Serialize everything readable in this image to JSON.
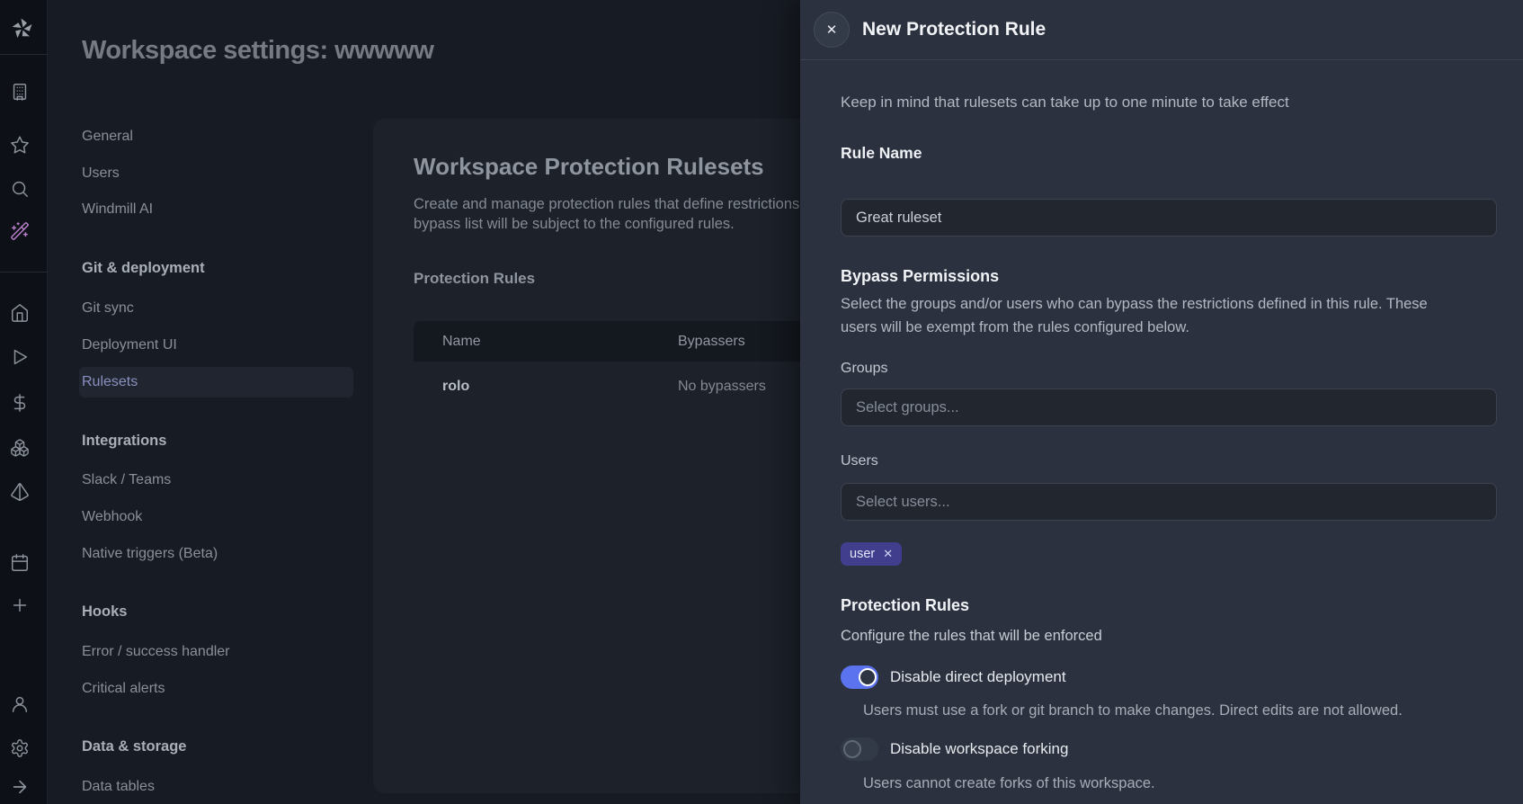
{
  "page": {
    "title": "Workspace settings: wwwww"
  },
  "sidebar_rail": {
    "icons": [
      "windmill-logo",
      "building",
      "star",
      "search",
      "magic-wand",
      "home",
      "play",
      "dollar",
      "boxes",
      "pyramid",
      "calendar",
      "plus",
      "user",
      "settings",
      "arrow-right"
    ]
  },
  "nav": {
    "items": [
      {
        "label": "General",
        "type": "item"
      },
      {
        "label": "Users",
        "type": "item"
      },
      {
        "label": "Windmill AI",
        "type": "item"
      },
      {
        "label": "Git & deployment",
        "type": "header"
      },
      {
        "label": "Git sync",
        "type": "item"
      },
      {
        "label": "Deployment UI",
        "type": "item"
      },
      {
        "label": "Rulesets",
        "type": "item",
        "selected": true
      },
      {
        "label": "Integrations",
        "type": "header"
      },
      {
        "label": "Slack / Teams",
        "type": "item"
      },
      {
        "label": "Webhook",
        "type": "item"
      },
      {
        "label": "Native triggers (Beta)",
        "type": "item"
      },
      {
        "label": "Hooks",
        "type": "header"
      },
      {
        "label": "Error / success handler",
        "type": "item"
      },
      {
        "label": "Critical alerts",
        "type": "item"
      },
      {
        "label": "Data & storage",
        "type": "header"
      },
      {
        "label": "Data tables",
        "type": "item"
      }
    ]
  },
  "content": {
    "heading": "Workspace Protection Rulesets",
    "description_lines": [
      "Create and manage protection rules that define restrictions for this workspace. Users not in the",
      "bypass list will be subject to the configured rules."
    ],
    "section_label": "Protection Rules",
    "table": {
      "columns": [
        "Name",
        "Bypassers"
      ],
      "rows": [
        {
          "name": "rolo",
          "bypassers": "No bypassers"
        }
      ]
    }
  },
  "drawer": {
    "title": "New Protection Rule",
    "close_glyph": "✕",
    "note": "Keep in mind that rulesets can take up to one minute to take effect",
    "rule_name": {
      "label": "Rule Name",
      "value": "Great ruleset"
    },
    "bypass": {
      "heading": "Bypass Permissions",
      "description_lines": [
        "Select the groups and/or users who can bypass the restrictions defined in this rule. These",
        "users will be exempt from the rules configured below."
      ],
      "groups_label": "Groups",
      "groups_placeholder": "Select groups...",
      "users_label": "Users",
      "users_placeholder": "Select users...",
      "selected_users": [
        {
          "label": "user",
          "remove_glyph": "✕"
        }
      ]
    },
    "rules": {
      "heading": "Protection Rules",
      "subheading": "Configure the rules that will be enforced",
      "toggles": [
        {
          "label": "Disable direct deployment",
          "description": "Users must use a fork or git branch to make changes. Direct edits are not allowed.",
          "enabled": true
        },
        {
          "label": "Disable workspace forking",
          "description": "Users cannot create forks of this workspace.",
          "enabled": false
        }
      ]
    }
  },
  "colors": {
    "toggle_on": "#5b73ee",
    "tag_bg": "#413e8e",
    "drawer_bg": "#2b313e",
    "card_bg": "#1c212a",
    "rail_bg": "#0d1117",
    "wand_accent": "#b77fc8"
  }
}
